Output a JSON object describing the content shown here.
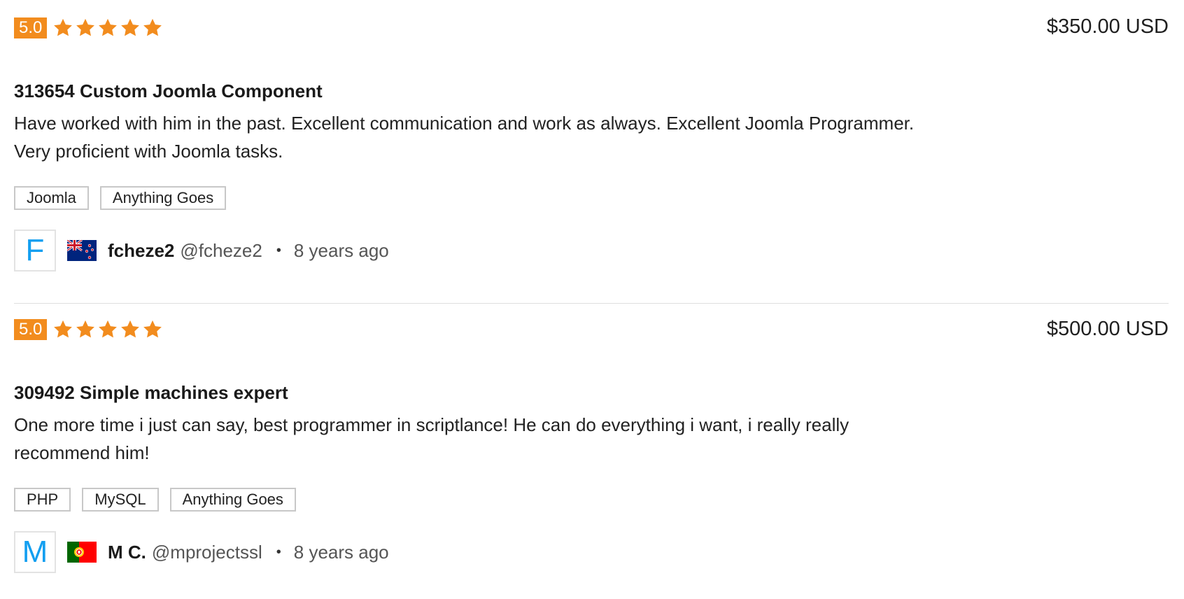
{
  "colors": {
    "badge": "#f28c1e",
    "star": "#f28c1e",
    "avatar_letter": "#139ff0",
    "divider": "#dedede",
    "tag_border": "#c8c8c8"
  },
  "reviews": [
    {
      "score": "5.0",
      "stars": 5,
      "price": "$350.00 USD",
      "title": "313654 Custom Joomla Component",
      "text": "Have worked with him in the past. Excellent communication and work as always. Excellent Joomla Programmer. Very proficient with Joomla tasks.",
      "tags": [
        "Joomla",
        "Anything Goes"
      ],
      "user": {
        "avatar_letter": "F",
        "flag": "new-zealand-flag-icon",
        "name": "fcheze2",
        "handle": "@fcheze2",
        "separator": "•",
        "time": "8 years ago"
      }
    },
    {
      "score": "5.0",
      "stars": 5,
      "price": "$500.00 USD",
      "title": "309492 Simple machines expert",
      "text": "One more time i just can say, best programmer in scriptlance! He can do everything i want, i really really recommend him!",
      "tags": [
        "PHP",
        "MySQL",
        "Anything Goes"
      ],
      "user": {
        "avatar_letter": "M",
        "flag": "portugal-flag-icon",
        "name": "M C.",
        "handle": "@mprojectssl",
        "separator": "•",
        "time": "8 years ago"
      }
    }
  ]
}
